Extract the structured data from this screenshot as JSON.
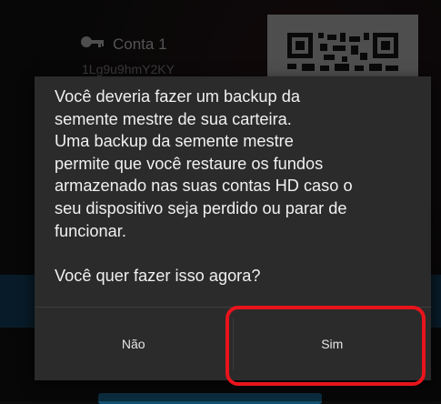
{
  "background": {
    "account_label": "Conta 1",
    "address": "1Lg9u9hmY2KY",
    "icons": {
      "key": "key-icon",
      "qr": "qr-code-icon"
    }
  },
  "dialog": {
    "message_lines": [
      "Você deveria fazer um backup da",
      "semente mestre de sua carteira.",
      "Uma backup da semente mestre",
      "permite que você restaure os fundos",
      "armazenado nas suas contas HD caso o",
      "seu dispositivo seja perdido ou parar de",
      "funcionar."
    ],
    "question": "Você quer fazer isso agora?",
    "negative_label": "Não",
    "positive_label": "Sim"
  },
  "colors": {
    "dialog_bg": "#2b2b2b",
    "highlight": "#e8141c",
    "banner": "#10324a"
  }
}
